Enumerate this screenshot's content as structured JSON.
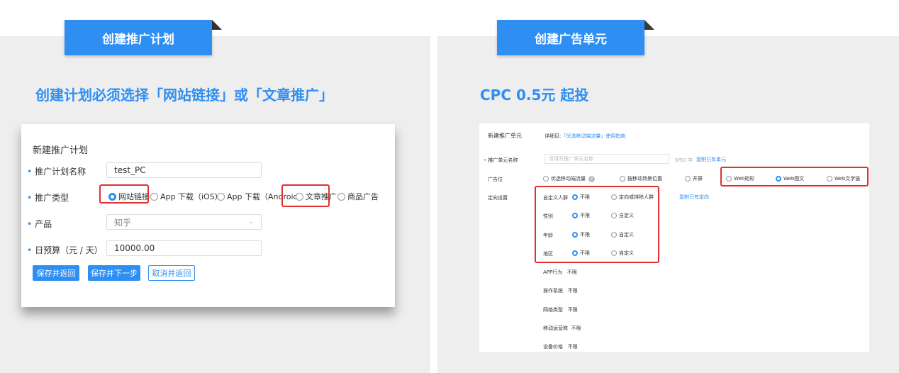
{
  "left": {
    "banner": "创建推广计划",
    "heading": "创建计划必须选择「网站链接」或「文章推广」",
    "form": {
      "title": "新建推广计划",
      "name_label": "推广计划名称",
      "name_value": "test_PC",
      "type_label": "推广类型",
      "types": [
        "网站链接",
        "App 下载（iOS）",
        "App 下载（Android）",
        "文章推广",
        "商品广告"
      ],
      "product_label": "产品",
      "product_value": "知乎",
      "budget_label": "日预算（元 / 天）",
      "budget_value": "10000.00",
      "save_return": "保存并返回",
      "save_next": "保存并下一步",
      "cancel_return": "取消并返回"
    }
  },
  "right": {
    "banner": "创建广告单元",
    "heading": "CPC  0.5元 起投",
    "form": {
      "title": "新建推广单元",
      "guide_prefix": "详细见:",
      "guide_link": "「优选移动端流量」使用指南",
      "unit_name_label": "推广单元名称",
      "unit_name_placeholder": "请填写推广单元名称",
      "unit_name_counter": "0/50 字",
      "copy_unit": "复制已有单元",
      "slot_label": "广告位",
      "slots": [
        "优选移动端流量",
        "按移动场景位置",
        "开屏",
        "Web矩形",
        "Web图文",
        "Web文字链"
      ],
      "help_icon_text": "?",
      "targeting_label": "定向设置",
      "copy_targeting": "复制已有定向",
      "custom_audience_label": "自定义人群",
      "custom_audience_options": [
        "不限",
        "定向或排除人群"
      ],
      "gender_label": "性别",
      "age_label": "年龄",
      "region_label": "地区",
      "unlimited": "不限",
      "custom": "自定义",
      "app_behavior_label": "APP行为",
      "os_label": "操作系统",
      "network_label": "网络类型",
      "carrier_label": "移动运营商",
      "device_price_label": "设备价格"
    }
  },
  "colors": {
    "accent": "#2e8ef2",
    "highlight": "#e03030",
    "panel_bg": "#eeeeee"
  }
}
